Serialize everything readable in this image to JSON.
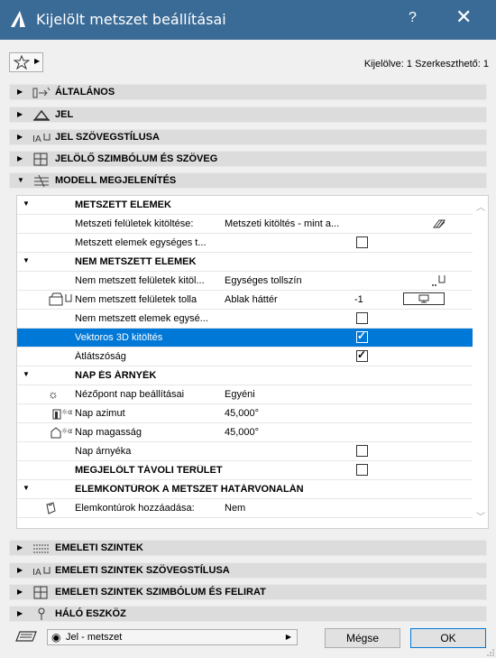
{
  "window": {
    "title": "Kijelölt metszet beállításai",
    "help": "?",
    "close": "✕"
  },
  "toolbar": {
    "selection_info": "Kijelölve: 1 Szerkeszthető: 1"
  },
  "panels_top": [
    {
      "label": "ÁLTALÁNOS"
    },
    {
      "label": "JEL"
    },
    {
      "label": "JEL SZÖVEGSTÍLUSA"
    },
    {
      "label": "JELÖLŐ SZIMBÓLUM ÉS SZÖVEG"
    },
    {
      "label": "MODELL MEGJELENÍTÉS"
    }
  ],
  "tree": {
    "rows": [
      {
        "kind": "group",
        "name": "METSZETT ELEMEK"
      },
      {
        "name": "Metszeti felületek kitöltése:",
        "value": "Metszeti kitöltés - mint a..."
      },
      {
        "name": "Metszett elemek egységes t...",
        "checked": false
      },
      {
        "kind": "group",
        "name": "NEM METSZETT ELEMEK"
      },
      {
        "name": "Nem metszett felületek kitöl...",
        "value": "Egységes tollszín"
      },
      {
        "name": "Nem metszett felületek tolla",
        "value": "Ablak háttér",
        "num": "-1"
      },
      {
        "name": "Nem metszett elemek egysé...",
        "checked": false
      },
      {
        "name": "Vektoros 3D kitöltés",
        "checked": true,
        "selected": true
      },
      {
        "name": "Átlátszóság",
        "checked": true
      },
      {
        "kind": "group",
        "name": "NAP ÉS ÁRNYÉK"
      },
      {
        "name": "Nézőpont nap beállításai",
        "value": "Egyéni"
      },
      {
        "name": "Nap azimut",
        "value": "45,000°"
      },
      {
        "name": "Nap magasság",
        "value": "45,000°"
      },
      {
        "name": "Nap árnyéka",
        "checked": false
      },
      {
        "kind": "group",
        "name": "MEGJELÖLT TÁVOLI TERÜLET",
        "checked": false
      },
      {
        "kind": "group",
        "name": "ELEMKONTÚROK A METSZET HATÁRVONALÁN"
      },
      {
        "name": "Elemkontúrok hozzáadása:",
        "value": "Nem"
      }
    ]
  },
  "panels_bottom": [
    {
      "label": "EMELETI SZINTEK"
    },
    {
      "label": "EMELETI SZINTEK SZÖVEGSTÍLUSA"
    },
    {
      "label": "EMELETI SZINTEK SZIMBÓLUM ÉS FELIRAT"
    },
    {
      "label": "HÁLÓ ESZKÖZ"
    }
  ],
  "footer": {
    "layer_value": "Jel - metszet",
    "cancel": "Mégse",
    "ok": "OK"
  },
  "colors": {
    "titlebar": "#3a6b96",
    "selection": "#0078d7"
  }
}
